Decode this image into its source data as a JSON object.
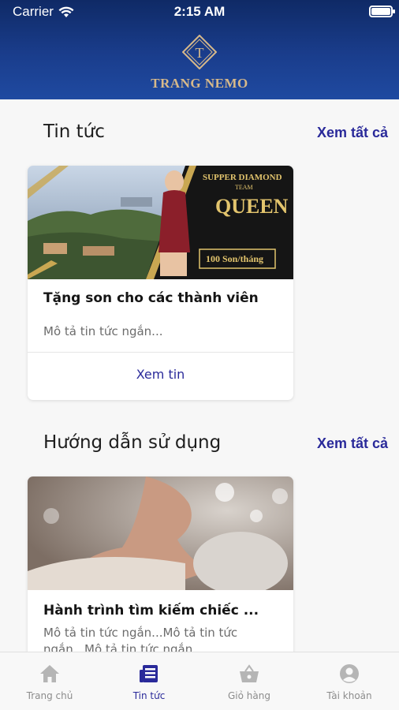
{
  "status": {
    "carrier": "Carrier",
    "time": "2:15 AM"
  },
  "brand": {
    "name": "TRANG NEMO",
    "monogram": "T"
  },
  "news": {
    "title": "Tin tức",
    "see_all": "Xem tất cả",
    "card": {
      "image_texts": [
        "SUPPER DIAMOND",
        "TEAM",
        "QUEEN",
        "100 Son/tháng"
      ],
      "title": "Tặng son cho các thành viên",
      "description": "Mô tả tin tức ngắn...",
      "link": "Xem tin"
    }
  },
  "guide": {
    "title": "Hướng dẫn sử dụng",
    "see_all": "Xem tất cả",
    "card": {
      "title": "Hành trình tìm kiếm chiếc ...",
      "description": "Mô tả tin tức ngắn...Mô tả tin tức ngắn...Mô tả tin tức ngắn..."
    }
  },
  "tabs": [
    {
      "label": "Trang chủ",
      "icon": "home-icon",
      "active": false
    },
    {
      "label": "Tin tức",
      "icon": "newspaper-icon",
      "active": true
    },
    {
      "label": "Giỏ hàng",
      "icon": "basket-icon",
      "active": false
    },
    {
      "label": "Tài khoản",
      "icon": "account-icon",
      "active": false
    }
  ],
  "colors": {
    "header": "#1a3d8c",
    "accent": "#2a2a9a",
    "gold": "#d7b98a"
  }
}
